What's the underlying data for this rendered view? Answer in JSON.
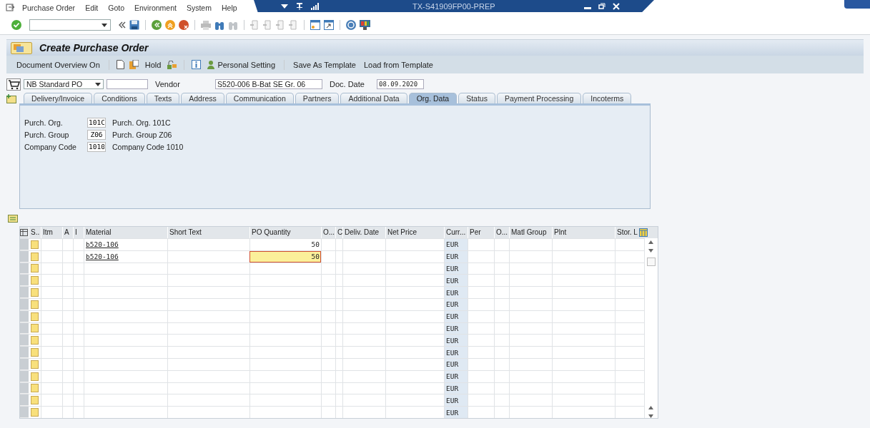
{
  "menu": [
    "Purchase Order",
    "Edit",
    "Goto",
    "Environment",
    "System",
    "Help"
  ],
  "window": {
    "title": "TX-S41909FP00-PREP"
  },
  "title": "Create Purchase Order",
  "app_toolbar": [
    "Document Overview On",
    "Hold",
    "Personal Setting",
    "Save As Template",
    "Load from Template"
  ],
  "header": {
    "doc_type": "NB Standard PO",
    "vendor_label": "Vendor",
    "vendor": "S520-006 B-Bat SE Gr. 06",
    "date_label": "Doc. Date",
    "date": "08.09.2020"
  },
  "tabs": [
    {
      "label": "Delivery/Invoice",
      "selected": false
    },
    {
      "label": "Conditions",
      "selected": false
    },
    {
      "label": "Texts",
      "selected": false
    },
    {
      "label": "Address",
      "selected": false
    },
    {
      "label": "Communication",
      "selected": false
    },
    {
      "label": "Partners",
      "selected": false
    },
    {
      "label": "Additional Data",
      "selected": false
    },
    {
      "label": "Org. Data",
      "selected": true
    },
    {
      "label": "Status",
      "selected": false
    },
    {
      "label": "Payment Processing",
      "selected": false
    },
    {
      "label": "Incoterms",
      "selected": false
    }
  ],
  "org_fields": [
    {
      "label": "Purch. Org.",
      "code": "101C",
      "description": "Purch. Org. 101C"
    },
    {
      "label": "Purch. Group",
      "code": "Z06",
      "description": "Purch. Group Z06"
    },
    {
      "label": "Company Code",
      "code": "1010",
      "description": "Company Code 1010"
    }
  ],
  "table": {
    "columns": [
      "S..",
      "Itm",
      "A",
      "I",
      "Material",
      "Short Text",
      "PO Quantity",
      "O...",
      "C",
      "Deliv. Date",
      "Net Price",
      "Curr...",
      "Per",
      "O...",
      "Matl Group",
      "Plnt",
      "Stor. L"
    ],
    "rows": [
      {
        "material": "b520-106",
        "quantity": "50",
        "currency": "EUR",
        "focused": false
      },
      {
        "material": "b520-106",
        "quantity": "50",
        "currency": "EUR",
        "focused": true
      },
      {
        "currency": "EUR",
        "focused": false
      },
      {
        "currency": "EUR",
        "focused": false
      },
      {
        "currency": "EUR",
        "focused": false
      },
      {
        "currency": "EUR",
        "focused": false
      },
      {
        "currency": "EUR",
        "focused": false
      },
      {
        "currency": "EUR",
        "focused": false
      },
      {
        "currency": "EUR",
        "focused": false
      },
      {
        "currency": "EUR",
        "focused": false
      },
      {
        "currency": "EUR",
        "focused": false
      },
      {
        "currency": "EUR",
        "focused": false
      },
      {
        "currency": "EUR",
        "focused": false
      },
      {
        "currency": "EUR",
        "focused": false
      },
      {
        "currency": "EUR",
        "focused": false
      }
    ]
  }
}
